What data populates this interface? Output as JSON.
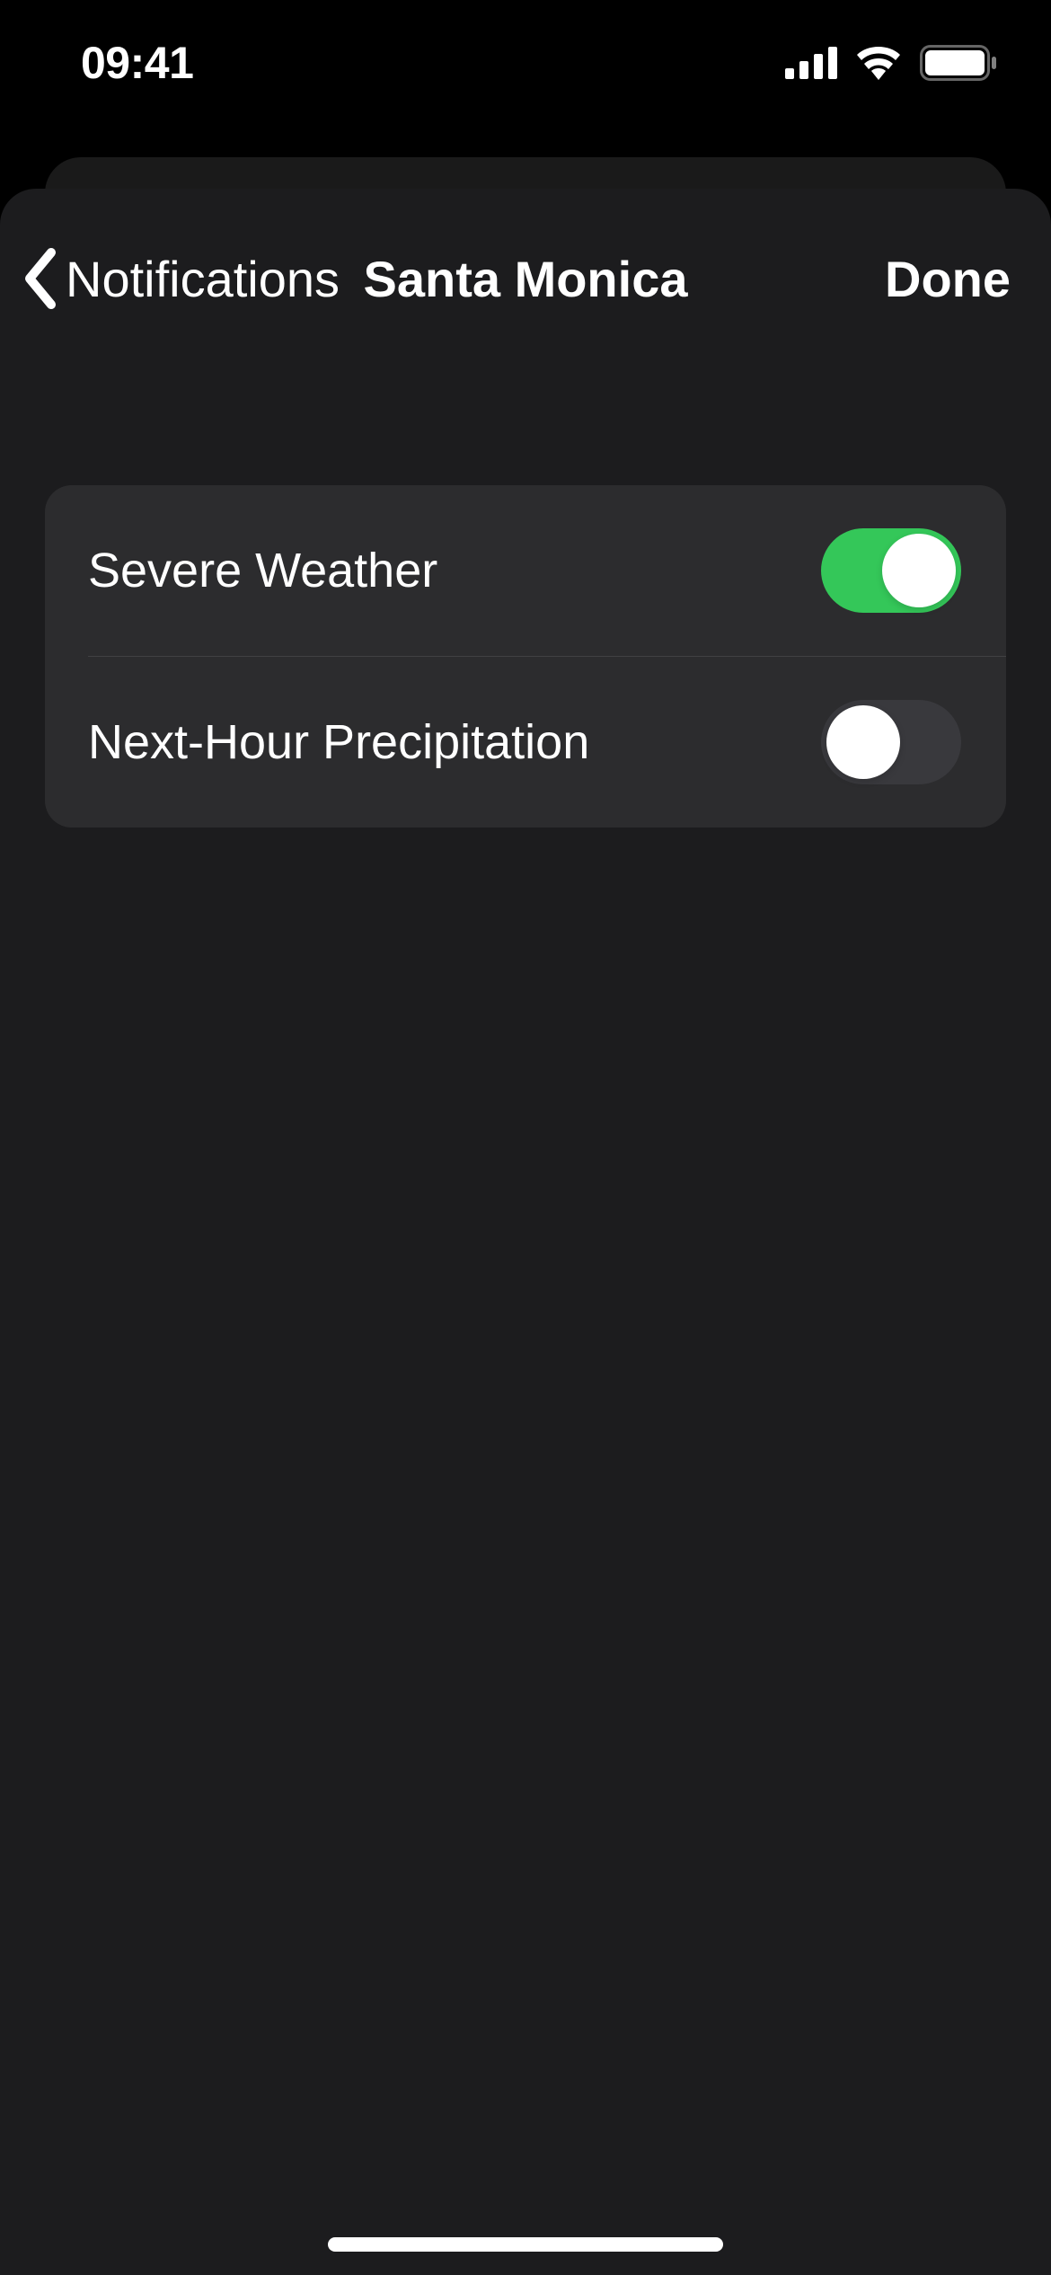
{
  "status_bar": {
    "time": "09:41"
  },
  "nav": {
    "back_label": "Notifications",
    "title": "Santa Monica",
    "done_label": "Done"
  },
  "settings": [
    {
      "label": "Severe Weather",
      "on": true
    },
    {
      "label": "Next-Hour Precipitation",
      "on": false
    }
  ]
}
